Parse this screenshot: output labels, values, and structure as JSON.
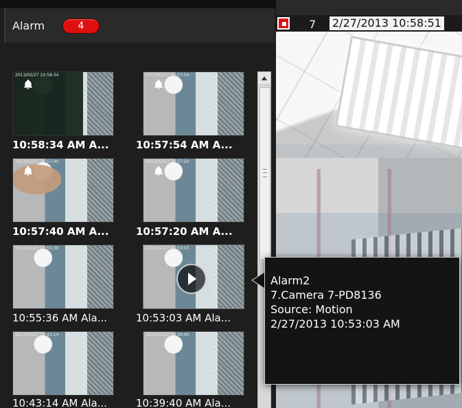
{
  "colors": {
    "panel_bg": "#1e1e1e",
    "badge_red": "#e01010",
    "text_white": "#ffffff",
    "tooltip_bg": "#141414",
    "tooltip_border": "#d0d0d0"
  },
  "alarm_panel": {
    "title": "Alarm",
    "count": "4",
    "thumbnails": [
      {
        "time_label": "10:58:34 AM A...",
        "overlay_ts": "2013/02/27 10:58:34",
        "icon": "bell-icon",
        "label_style": "bold",
        "visual": "dark"
      },
      {
        "time_label": "10:57:54 AM A...",
        "overlay_ts": "2013/02/27 10:57:54",
        "icon": "bell-icon",
        "label_style": "bold",
        "visual": "normal"
      },
      {
        "time_label": "10:57:40 AM A...",
        "overlay_ts": "2013/02/27 10:57:40",
        "icon": "bell-icon",
        "label_style": "bold",
        "visual": "hand"
      },
      {
        "time_label": "10:57:20 AM A...",
        "overlay_ts": "2013/02/27 10:57:20",
        "icon": "bell-icon",
        "label_style": "bold",
        "visual": "normal"
      },
      {
        "time_label": "10:55:36 AM Ala...",
        "overlay_ts": "2013/02/27 10:55:36",
        "icon": "",
        "label_style": "normal",
        "visual": "normal"
      },
      {
        "time_label": "10:53:03 AM Ala...",
        "overlay_ts": "2013/02/27 10:53:03",
        "icon": "play-icon",
        "label_style": "normal",
        "visual": "normal"
      },
      {
        "time_label": "",
        "overlay_ts": "2013/02/27 10:43:14",
        "icon": "",
        "label_style": "normal",
        "visual": "normal"
      },
      {
        "time_label": "",
        "overlay_ts": "2013/02/27 10:39:40",
        "icon": "",
        "label_style": "normal",
        "visual": "normal"
      }
    ],
    "footer_labels": [
      "10:43:14 AM Ala...",
      "10:39:40 AM Ala..."
    ]
  },
  "camera_view": {
    "record_icon": "record-icon",
    "camera_number": "7",
    "timestamp": "2/27/2013 10:58:51"
  },
  "tooltip": {
    "line1": "Alarm2",
    "line2": "7.Camera 7-PD8136",
    "line3": "Source: Motion",
    "line4": "2/27/2013 10:53:03 AM"
  }
}
